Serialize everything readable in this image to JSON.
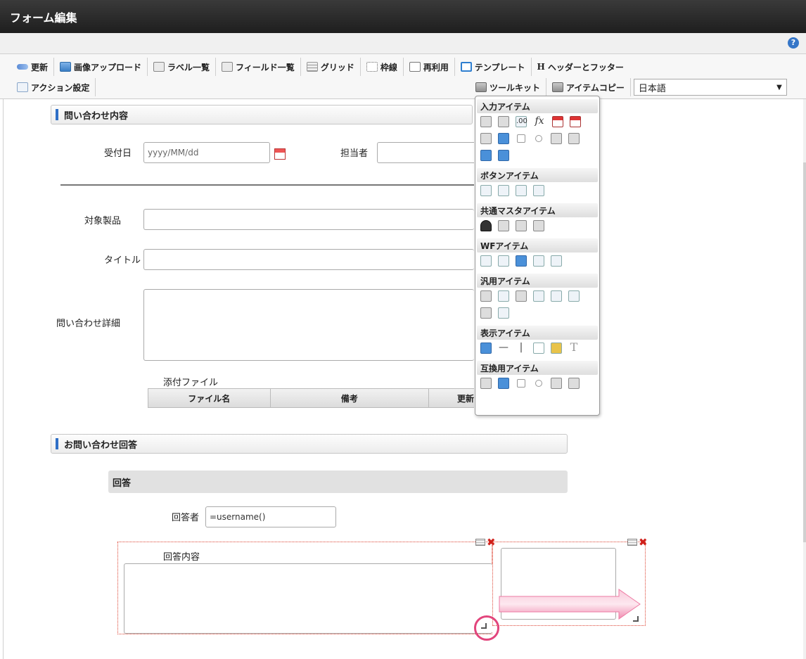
{
  "app": {
    "title": "フォーム編集",
    "help_icon": "?"
  },
  "toolbar": {
    "update": "更新",
    "image_upload": "画像アップロード",
    "label_list": "ラベル一覧",
    "field_list": "フィールド一覧",
    "grid": "グリッド",
    "frame": "枠線",
    "reuse": "再利用",
    "template": "テンプレート",
    "header_footer_icon": "H",
    "header_footer": "ヘッダーとフッター",
    "action_settings": "アクション設定",
    "toolkit": "ツールキット",
    "item_copy": "アイテムコピー",
    "language": "日本語",
    "language_caret": "▼"
  },
  "form": {
    "section1": "問い合わせ内容",
    "received_date_label": "受付日",
    "received_date_placeholder": "yyyy/MM/dd",
    "assignee_label": "担当者",
    "product_label": "対象製品",
    "title_label": "タイトル",
    "detail_label": "問い合わせ詳細",
    "attachment_label": "添付ファイル",
    "attachment_columns": [
      "ファイル名",
      "備考",
      "更新"
    ],
    "section2": "お問い合わせ回答",
    "answer_subheader": "回答",
    "responder_label": "回答者",
    "responder_value": "=username()",
    "answer_content_label": "回答内容"
  },
  "palette": {
    "input_items": "入力アイテム",
    "button_items": "ボタンアイテム",
    "master_items": "共通マスタアイテム",
    "wf_items": "WFアイテム",
    "general_items": "汎用アイテム",
    "display_items": "表示アイテム",
    "compat_items": "互換用アイテム",
    "icon_fx": "fx",
    "icon_decimal": ".00",
    "icon_t": "T",
    "icon_dash": "—",
    "icon_pipe": "|"
  },
  "colors": {
    "accent": "#2f6fc6",
    "highlight": "#e2457c",
    "selection": "#dd4433"
  }
}
